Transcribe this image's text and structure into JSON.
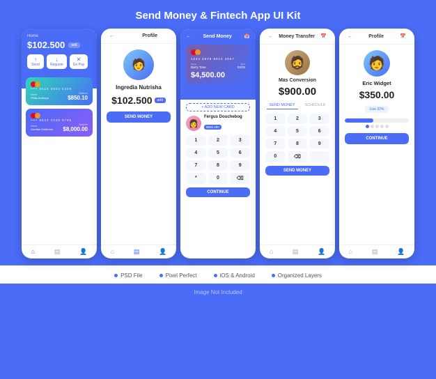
{
  "page": {
    "title": "Send Money & Fintech App UI Kit",
    "bg_color": "#4a6cf7"
  },
  "phone1": {
    "screen_label": "Home",
    "amount": "$102.500",
    "add_label": "add",
    "actions": [
      "Send",
      "Request",
      "Go Pay"
    ],
    "card1": {
      "num": "•••• 5618 6602 5459",
      "name": "Philip Amtropp",
      "date": "12/24",
      "balance": "$850.10"
    },
    "card2": {
      "num": "•••• 6543 2038 9795",
      "name": "Gordian Martinton",
      "date": "04/21",
      "balance": "$8,000.00"
    }
  },
  "phone2": {
    "screen_label": "Profile",
    "name": "Ingredia Nutrisha",
    "balance": "$102.500",
    "badge": "add",
    "btn_label": "SEND MONEY"
  },
  "phone3": {
    "screen_label": "Send Money",
    "card_num": "1234 5678 9012 4567",
    "card_name": "Barry Tone",
    "card_date": "03/25",
    "amount": "$4,500.00",
    "add_card": "+ ADD NEW CARD",
    "recipient_name": "Fergus Douchebog",
    "recipient_balance": "$500.200",
    "numpad": [
      "1",
      "2",
      "3",
      "4",
      "5",
      "6",
      "7",
      "8",
      "9",
      "*",
      "0",
      "⌫"
    ],
    "continue_label": "CONTINUE"
  },
  "phone4": {
    "screen_label": "Money Transfer",
    "name": "Mas Conversion",
    "amount": "$900.00",
    "tabs": [
      "SEND MONEY",
      "SCHEDULE"
    ],
    "numpad": [
      "1",
      "2",
      "3",
      "4",
      "5",
      "6",
      "7",
      "8",
      "9",
      "0",
      "⌫",
      ""
    ],
    "btn_label": "SEND MONEY"
  },
  "phone5": {
    "screen_label": "Profile",
    "name": "Eric Widget",
    "amount": "$350.00",
    "badge": "Liue 32%",
    "btn_label": "CONTINUE"
  },
  "footer": {
    "items": [
      "PSD File",
      "Pixel Perfect",
      "iOS & Android",
      "Organized Layers"
    ],
    "bottom": "Image Not Included"
  }
}
